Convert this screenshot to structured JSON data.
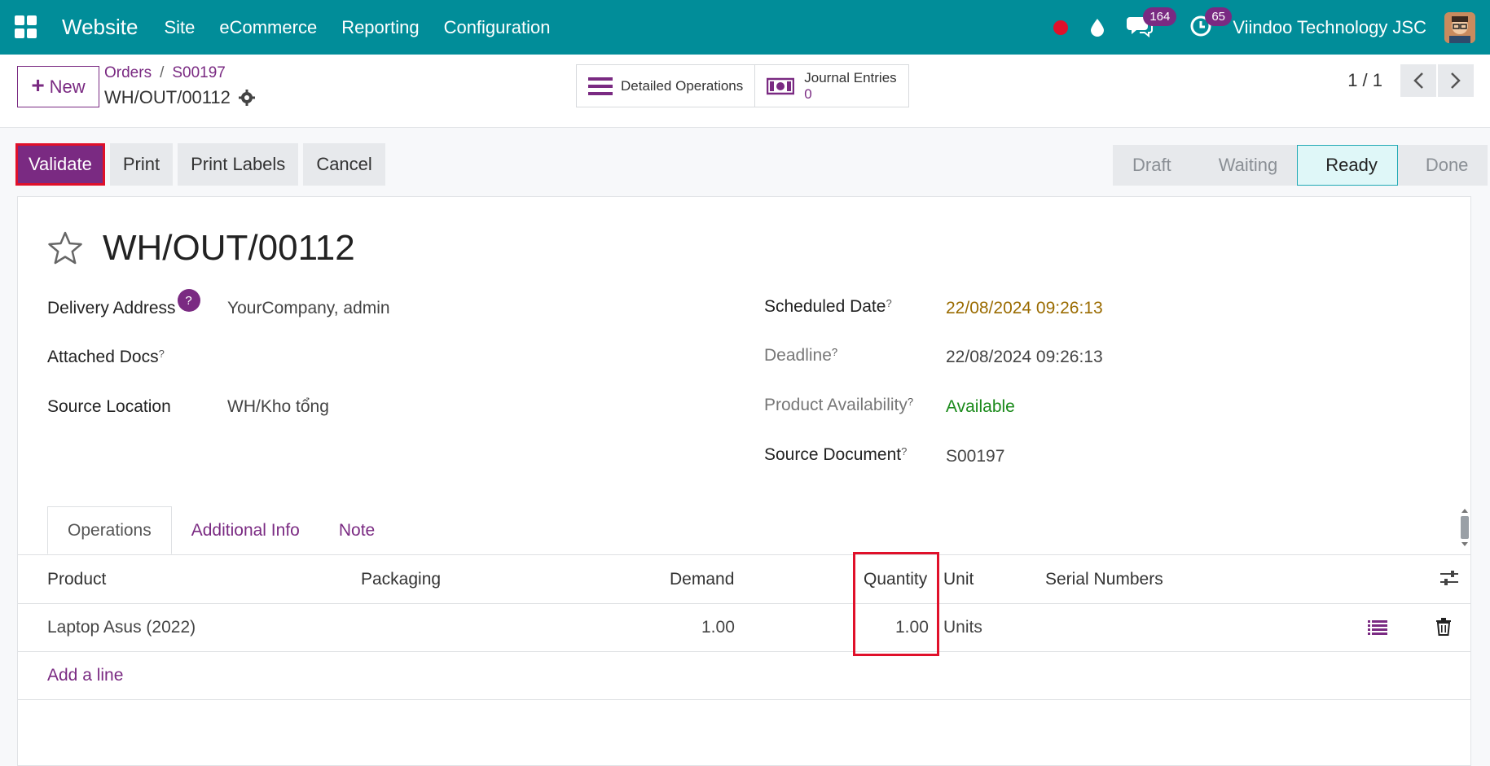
{
  "navbar": {
    "app_name": "Website",
    "menu": [
      "Site",
      "eCommerce",
      "Reporting",
      "Configuration"
    ],
    "messages_count": "164",
    "activities_count": "65",
    "company": "Viindoo Technology JSC"
  },
  "control": {
    "new_label": "New",
    "breadcrumb": [
      "Orders",
      "S00197"
    ],
    "record_name": "WH/OUT/00112",
    "stat_detailed": "Detailed Operations",
    "stat_journal_label": "Journal Entries",
    "stat_journal_value": "0",
    "pager": "1 / 1"
  },
  "actions": {
    "validate": "Validate",
    "print": "Print",
    "print_labels": "Print Labels",
    "cancel": "Cancel"
  },
  "status": {
    "stages": [
      "Draft",
      "Waiting",
      "Ready",
      "Done"
    ],
    "active": "Ready"
  },
  "form": {
    "title": "WH/OUT/00112",
    "delivery_address_label": "Delivery Address",
    "delivery_address_value": "YourCompany, admin",
    "attached_docs_label": "Attached Docs",
    "source_location_label": "Source Location",
    "source_location_value": "WH/Kho tổng",
    "scheduled_date_label": "Scheduled Date",
    "scheduled_date_value": "22/08/2024 09:26:13",
    "deadline_label": "Deadline",
    "deadline_value": "22/08/2024 09:26:13",
    "availability_label": "Product Availability",
    "availability_value": "Available",
    "source_document_label": "Source Document",
    "source_document_value": "S00197",
    "help_q": "?",
    "help_sup": "?"
  },
  "tabs": [
    "Operations",
    "Additional Info",
    "Note"
  ],
  "table": {
    "headers": [
      "Product",
      "Packaging",
      "Demand",
      "Quantity",
      "Unit",
      "Serial Numbers"
    ],
    "rows": [
      {
        "product": "Laptop Asus (2022)",
        "packaging": "",
        "demand": "1.00",
        "quantity": "1.00",
        "unit": "Units",
        "serial": ""
      }
    ],
    "add_line": "Add a line"
  },
  "colors": {
    "navbar": "#018d99",
    "primary": "#7a2a82",
    "highlight": "#e0102a",
    "scheduled": "#9a6b00",
    "available": "#1a8a1a"
  }
}
